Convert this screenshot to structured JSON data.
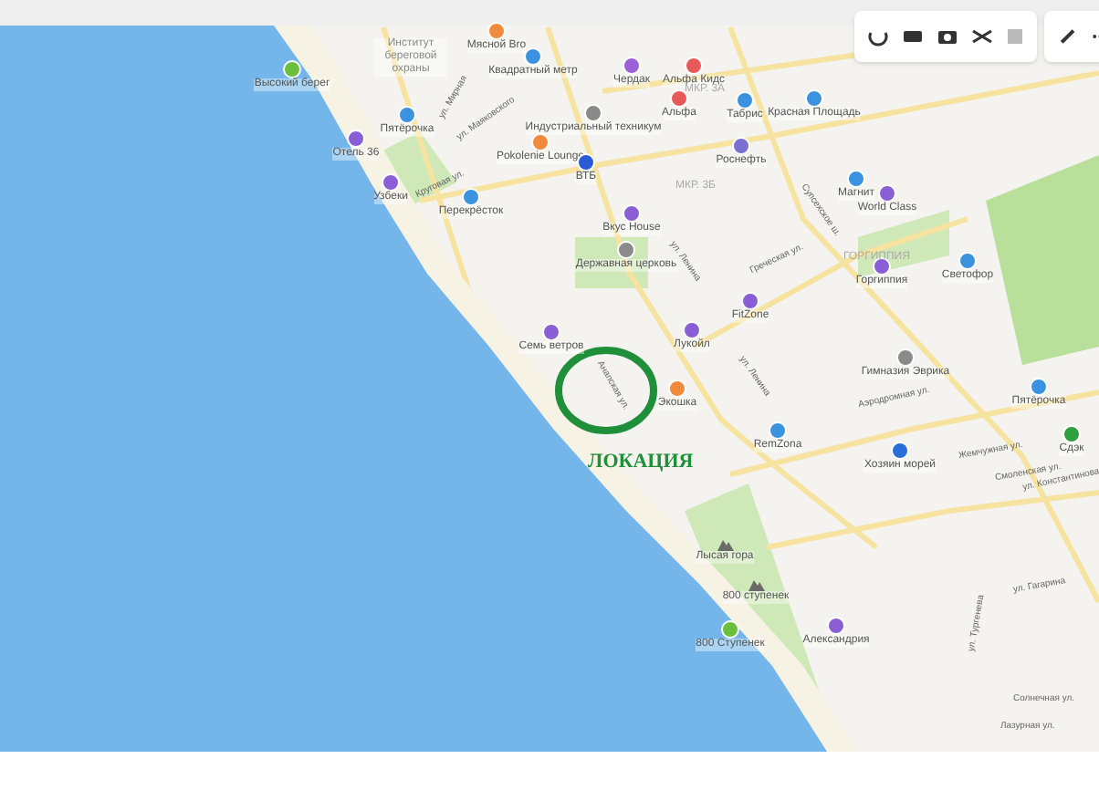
{
  "map": {
    "pois": [
      {
        "label": "Высокий берег",
        "kind": "pin",
        "color": "#6bbf3b"
      },
      {
        "label": "Институт береговой охраны",
        "kind": "text",
        "color": "#8a8a8a"
      },
      {
        "label": "Мясной Bro",
        "kind": "pin",
        "color": "#f08a3c"
      },
      {
        "label": "Квадратный метр",
        "kind": "pin",
        "color": "#3b93e0"
      },
      {
        "label": "Чердак",
        "kind": "pin",
        "color": "#9b5fd6"
      },
      {
        "label": "Альфа Кидс",
        "kind": "pin",
        "color": "#e85a5a"
      },
      {
        "label": "Альфа",
        "kind": "pin",
        "color": "#e85a5a"
      },
      {
        "label": "Табрис",
        "kind": "pin",
        "color": "#3b93e0"
      },
      {
        "label": "Красная Площадь",
        "kind": "pin",
        "color": "#3b93e0"
      },
      {
        "label": "Пятёрочка",
        "kind": "pin",
        "color": "#3b93e0"
      },
      {
        "label": "Отель 36",
        "kind": "pin",
        "color": "#8a5fd6"
      },
      {
        "label": "Индустриальный техникум",
        "kind": "pin",
        "color": "#8a8a8a"
      },
      {
        "label": "Pokolenie Lounge",
        "kind": "pin",
        "color": "#f08a3c"
      },
      {
        "label": "ВТБ",
        "kind": "pin",
        "color": "#2a5bd7"
      },
      {
        "label": "Узбеки",
        "kind": "pin",
        "color": "#8a5fd6"
      },
      {
        "label": "Перекрёсток",
        "kind": "pin",
        "color": "#3b93e0"
      },
      {
        "label": "Роснефть",
        "kind": "pin",
        "color": "#7a6fd0"
      },
      {
        "label": "Магнит",
        "kind": "pin",
        "color": "#3b93e0"
      },
      {
        "label": "World Class",
        "kind": "pin",
        "color": "#8a5fd6"
      },
      {
        "label": "Вкус House",
        "kind": "pin",
        "color": "#8a5fd6"
      },
      {
        "label": "Державная церковь",
        "kind": "pin",
        "color": "#8a8a8a"
      },
      {
        "label": "Лукойл",
        "kind": "pin",
        "color": "#8a5fd6"
      },
      {
        "label": "Семь ветров",
        "kind": "pin",
        "color": "#8a5fd6"
      },
      {
        "label": "Экошка",
        "kind": "pin",
        "color": "#f08a3c"
      },
      {
        "label": "FitZone",
        "kind": "pin",
        "color": "#8a5fd6"
      },
      {
        "label": "Горгиппия",
        "kind": "pin",
        "color": "#8a5fd6"
      },
      {
        "label": "Светофор",
        "kind": "pin",
        "color": "#3b93e0"
      },
      {
        "label": "Гимназия Эврика",
        "kind": "pin",
        "color": "#8a8a8a"
      },
      {
        "label": "Пятёрочка",
        "kind": "pin",
        "color": "#3b93e0"
      },
      {
        "label": "RemZona",
        "kind": "pin",
        "color": "#3b93e0"
      },
      {
        "label": "Хозяин морей",
        "kind": "pin",
        "color": "#2a6fd7"
      },
      {
        "label": "Сдэк",
        "kind": "pin",
        "color": "#2e9e3e"
      },
      {
        "label": "Лысая гора",
        "kind": "peak",
        "color": "#6a6a6a"
      },
      {
        "label": "800 ступенек",
        "kind": "peak",
        "color": "#6a6a6a"
      },
      {
        "label": "800 Ступенек",
        "kind": "pin",
        "color": "#6bbf3b"
      },
      {
        "label": "Александрия",
        "kind": "pin",
        "color": "#8a5fd6"
      }
    ],
    "districts": [
      "МКР. 3А",
      "МКР. 3Б",
      "ГОРГИППИЯ"
    ],
    "streets": [
      "ул. Мирная",
      "ул. Маяковского",
      "Круговая ул.",
      "ул. Ленина",
      "Греческая ул.",
      "Супсехское ш.",
      "Анапская ул.",
      "ул. Ленина",
      "Аэродромная ул.",
      "Жемчужная ул.",
      "Смоленская ул.",
      "ул. Константинова",
      "ул. Тургенева",
      "Солнечная ул.",
      "Лазурная ул.",
      "ул. Гагарина"
    ],
    "annotation": {
      "label": "ЛОКАЦИЯ"
    }
  }
}
